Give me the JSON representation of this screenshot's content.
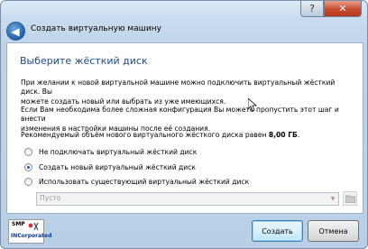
{
  "window": {
    "help_label": "?",
    "close_label": "✕",
    "title": "Создать виртуальную машину"
  },
  "page": {
    "heading": "Выберите жёсткий диск",
    "para1_line1": "При желании к новой виртуальной машине можно подключить виртуальный жёсткий диск. Вы",
    "para1_line2": "можете создать новый или выбрать из уже имеющихся.",
    "para2_line1": "Если Вам необходима более сложная конфигурация Вы можете пропустить этот шаг и внести",
    "para2_line2": "изменения в настройки машины после её создания.",
    "recommend_prefix": "Рекомендуемый объём нового виртуального жёсткого диска равен ",
    "recommend_size": "8,00 ГБ",
    "recommend_suffix": "."
  },
  "options": [
    {
      "label": "Не подключать виртуальный жёсткий диск",
      "selected": false
    },
    {
      "label": "Создать новый виртуальный жёсткий диск",
      "selected": true
    },
    {
      "label": "Использовать существующий виртуальный жёсткий диск",
      "selected": false
    }
  ],
  "disk_select": {
    "value": "Пусто",
    "enabled": false
  },
  "logo": {
    "line1": "SMP",
    "line2": "INCorporated"
  },
  "footer": {
    "create_label": "Создать",
    "cancel_label": "Отмена"
  },
  "colors": {
    "title_blue": "#1b4a8a",
    "radio_dot": "#2a5ea8"
  }
}
